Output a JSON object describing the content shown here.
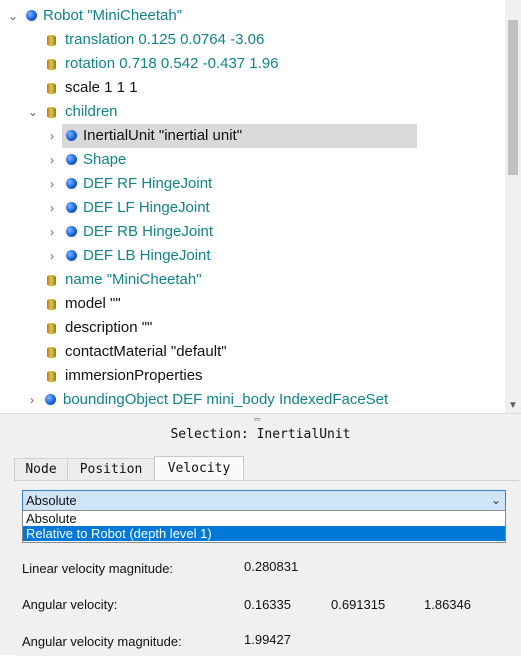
{
  "tree": {
    "header_partial": "Robot \"MiniCheetah\"",
    "nodes": [
      {
        "text": "Robot \"MiniCheetah\"",
        "icon": "dot",
        "arrow": "expanded"
      },
      {
        "text": "translation 0.125 0.0764 -3.06",
        "icon": "cyl"
      },
      {
        "text": "rotation 0.718 0.542 -0.437 1.96",
        "icon": "cyl"
      },
      {
        "text": "scale 1 1 1",
        "icon": "cyl"
      },
      {
        "text": "children",
        "icon": "cyl",
        "arrow": "expanded"
      },
      {
        "text": "InertialUnit \"inertial unit\"",
        "icon": "dot",
        "arrow": "collapsed",
        "selected": true
      },
      {
        "text": "Shape",
        "icon": "dot",
        "arrow": "collapsed"
      },
      {
        "text": "DEF RF HingeJoint",
        "icon": "dot",
        "arrow": "collapsed"
      },
      {
        "text": "DEF LF HingeJoint",
        "icon": "dot",
        "arrow": "collapsed"
      },
      {
        "text": "DEF RB HingeJoint",
        "icon": "dot",
        "arrow": "collapsed"
      },
      {
        "text": "DEF LB HingeJoint",
        "icon": "dot",
        "arrow": "collapsed"
      },
      {
        "text": "name \"MiniCheetah\"",
        "icon": "cyl"
      },
      {
        "text": "model \"\"",
        "icon": "cyl"
      },
      {
        "text": "description \"\"",
        "icon": "cyl"
      },
      {
        "text": "contactMaterial \"default\"",
        "icon": "cyl"
      },
      {
        "text": "immersionProperties",
        "icon": "cyl"
      },
      {
        "text": "boundingObject DEF mini_body IndexedFaceSet",
        "icon": "dot",
        "arrow": "collapsed"
      }
    ]
  },
  "selection_title": "Selection: InertialUnit",
  "tabs": [
    {
      "label": "Node"
    },
    {
      "label": "Position"
    },
    {
      "label": "Velocity",
      "active": true
    }
  ],
  "velocity": {
    "combo_value": "Absolute",
    "options": [
      "Absolute",
      "Relative to Robot (depth level 1)"
    ],
    "highlighted_option": "Relative to Robot (depth level 1)",
    "linear_label": "Linear velocity magnitude:",
    "linear_value": "0.280831",
    "angular_label": "Angular velocity:",
    "angular_x": "0.16335",
    "angular_y": "0.691315",
    "angular_z": "1.86346",
    "angular_mag_label": "Angular velocity magnitude:",
    "angular_mag_value": "1.99427"
  },
  "colors": {
    "field_text": "#11848a",
    "node_icon": "#1a63d6",
    "field_icon": "#c9a12e",
    "selection_highlight": "#0078d7",
    "combo_bg": "#cfe4f7"
  }
}
